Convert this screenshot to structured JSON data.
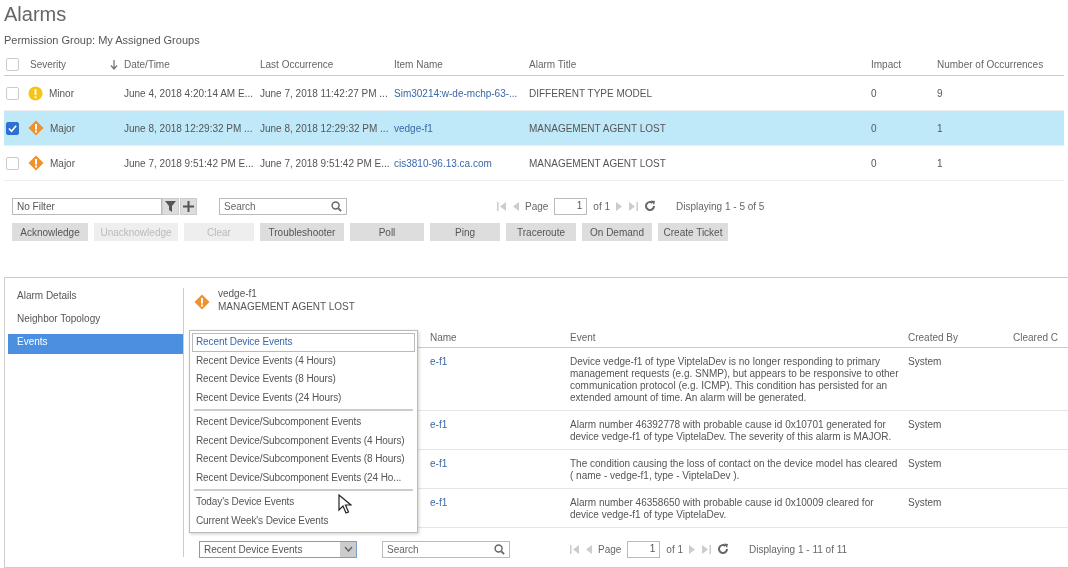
{
  "page_title": "Alarms",
  "permission_group": "Permission Group: My Assigned Groups",
  "alarm_table": {
    "header_checked": false,
    "columns": [
      {
        "label": "Severity",
        "sorted": false
      },
      {
        "label": "Date/Time",
        "sorted": true
      },
      {
        "label": "Last Occurrence",
        "sorted": false
      },
      {
        "label": "Item Name",
        "sorted": false
      },
      {
        "label": "Alarm Title",
        "sorted": false
      },
      {
        "label": "Impact",
        "sorted": false
      },
      {
        "label": "Number of Occurrences",
        "sorted": false
      }
    ],
    "rows": [
      {
        "selected": false,
        "checked": false,
        "kind": "minor",
        "severity": "Minor",
        "date_time": "June 4, 2018 4:20:14 AM E...",
        "last_occurrence": "June 7, 2018 11:42:27 PM ...",
        "item_name": "Sim30214:w-de-mchp-63-...",
        "alarm_title": "DIFFERENT TYPE MODEL",
        "impact": "0",
        "occurrences": "9"
      },
      {
        "selected": true,
        "checked": true,
        "kind": "major",
        "severity": "Major",
        "date_time": "June 8, 2018 12:29:32 PM ...",
        "last_occurrence": "June 8, 2018 12:29:32 PM ...",
        "item_name": "vedge-f1",
        "alarm_title": "MANAGEMENT AGENT LOST",
        "impact": "0",
        "occurrences": "1"
      },
      {
        "selected": false,
        "checked": false,
        "kind": "major",
        "severity": "Major",
        "date_time": "June 7, 2018 9:51:42 PM E...",
        "last_occurrence": "June 7, 2018 9:51:42 PM E...",
        "item_name": "cis3810-96.13.ca.com",
        "alarm_title": "MANAGEMENT AGENT LOST",
        "impact": "0",
        "occurrences": "1"
      }
    ]
  },
  "filter": {
    "value": "No Filter"
  },
  "search": {
    "placeholder": "Search"
  },
  "pager": {
    "label": "Page",
    "page": "1",
    "of": "of 1",
    "display": "Displaying 1 - 5 of 5"
  },
  "actions": [
    {
      "label": "Acknowledge",
      "disabled": false
    },
    {
      "label": "Unacknowledge",
      "disabled": true
    },
    {
      "label": "Clear",
      "disabled": true
    },
    {
      "label": "Troubleshooter",
      "disabled": false
    },
    {
      "label": "Poll",
      "disabled": false
    },
    {
      "label": "Ping",
      "disabled": false
    },
    {
      "label": "Traceroute",
      "disabled": false
    },
    {
      "label": "On Demand",
      "disabled": false
    },
    {
      "label": "Create Ticket",
      "disabled": false
    }
  ],
  "detail_nav": [
    {
      "label": "Alarm Details",
      "selected": false
    },
    {
      "label": "Neighbor Topology",
      "selected": false
    },
    {
      "label": "Events",
      "selected": true
    }
  ],
  "detail": {
    "kind": "major",
    "item": "vedge-f1",
    "title": "MANAGEMENT AGENT LOST"
  },
  "events_table": {
    "columns": [
      {
        "label": "Name"
      },
      {
        "label": "Event"
      },
      {
        "label": "Created By"
      },
      {
        "label": "Cleared C"
      }
    ],
    "rows": [
      {
        "name": "e-f1",
        "event": "Device vedge-f1 of type ViptelaDev is no longer responding to primary management requests (e.g. SNMP), but appears to be responsive to other communication protocol (e.g. ICMP). This condition has persisted for an extended amount of time. An alarm will be generated.",
        "created_by": "System"
      },
      {
        "name": "e-f1",
        "event": "Alarm number 46392778 with probable cause id 0x10701 generated for device vedge-f1 of type ViptelaDev. The severity of this alarm is MAJOR.",
        "created_by": "System"
      },
      {
        "name": "e-f1",
        "event": "The condition causing the loss of contact on the device model has cleared ( name - vedge-f1, type - ViptelaDev ).",
        "created_by": "System"
      },
      {
        "name": "e-f1",
        "event": "Alarm number 46358650 with probable cause id 0x10009 cleared for device vedge-f1 of type ViptelaDev.",
        "created_by": "System"
      }
    ]
  },
  "event_view": {
    "value": "Recent Device Events",
    "expanded": true,
    "groups": [
      {
        "options": [
          {
            "label": "Recent Device Events",
            "selected": true
          },
          {
            "label": "Recent Device Events (4 Hours)",
            "selected": false
          },
          {
            "label": "Recent Device Events (8 Hours)",
            "selected": false
          },
          {
            "label": "Recent Device Events (24 Hours)",
            "selected": false
          }
        ]
      },
      {
        "options": [
          {
            "label": "Recent Device/Subcomponent Events",
            "selected": false
          },
          {
            "label": "Recent Device/Subcomponent Events (4 Hours)",
            "selected": false
          },
          {
            "label": "Recent Device/Subcomponent Events (8 Hours)",
            "selected": false
          },
          {
            "label": "Recent Device/Subcomponent Events (24 Ho...",
            "selected": false
          }
        ]
      },
      {
        "options": [
          {
            "label": "Today's Device Events",
            "selected": false
          },
          {
            "label": "Current Week's Device Events",
            "selected": false
          }
        ]
      }
    ]
  },
  "events_search": {
    "placeholder": "Search"
  },
  "events_pager": {
    "label": "Page",
    "page": "1",
    "of": "of 1",
    "display": "Displaying 1 - 11 of 11"
  }
}
